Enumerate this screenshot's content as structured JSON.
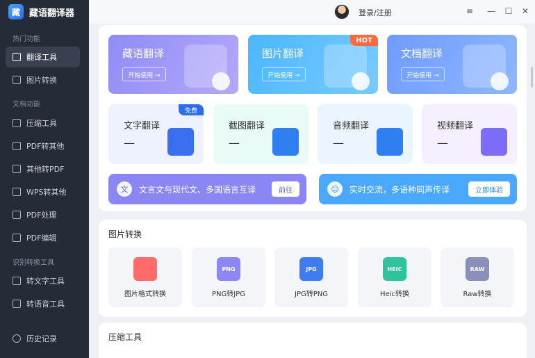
{
  "app": {
    "name": "藏语翻译器",
    "logo_text": "藏"
  },
  "topbar": {
    "login": "登录/注册",
    "menu_icon": "≡",
    "min_icon": "—",
    "max_icon": "☐",
    "close_icon": "✕"
  },
  "sidebar": {
    "sections": [
      {
        "title": "热门功能"
      },
      {
        "title": "文档功能"
      },
      {
        "title": "识别转换工具"
      }
    ],
    "items": [
      {
        "label": "翻译工具",
        "active": true
      },
      {
        "label": "图片转换"
      },
      {
        "label": "压缩工具"
      },
      {
        "label": "PDF转其他"
      },
      {
        "label": "其他转PDF"
      },
      {
        "label": "WPS转其他"
      },
      {
        "label": "PDF处理"
      },
      {
        "label": "PDF编辑"
      },
      {
        "label": "转文字工具"
      },
      {
        "label": "转语音工具"
      },
      {
        "label": "历史记录"
      }
    ]
  },
  "main": {
    "big_cards": [
      {
        "title": "藏语翻译",
        "button": "开始使用 →",
        "color1": "#8f8cf6",
        "color2": "#b4a8fb"
      },
      {
        "title": "图片翻译",
        "button": "开始使用 →",
        "badge": "HOT",
        "color1": "#4bb6ff",
        "color2": "#79cbff"
      },
      {
        "title": "文档翻译",
        "button": "开始使用 →",
        "color1": "#6f9bff",
        "color2": "#8fb7ff"
      }
    ],
    "small_cards": [
      {
        "title": "文字翻译",
        "value": "—",
        "badge": "免费",
        "bg": "#eef2ff",
        "art": "#3a6ff0"
      },
      {
        "title": "截图翻译",
        "value": "—",
        "bg": "#e9fbf7",
        "art": "#2f7ff0"
      },
      {
        "title": "音频翻译",
        "value": "—",
        "bg": "#eaf5ff",
        "art": "#2f7ff0"
      },
      {
        "title": "视频翻译",
        "value": "—",
        "bg": "#f6efff",
        "art": "#7c6cf6"
      }
    ],
    "wide_cards": [
      {
        "icon": "文",
        "text": "文言文与现代文、多国语言互译",
        "button": "前往",
        "color": "#8a86f3"
      },
      {
        "icon": "☺",
        "text": "实时交流，多语种同声传译",
        "button": "立即体验",
        "color": "#4aa8ff"
      }
    ],
    "image_section": {
      "title": "图片转换",
      "tools": [
        {
          "label": "图片格式转换",
          "icon_text": "",
          "color": "#ff6b6b"
        },
        {
          "label": "PNG转JPG",
          "icon_text": "PNG",
          "color": "#8d86f3"
        },
        {
          "label": "JPG转PNG",
          "icon_text": "JPG",
          "color": "#3f7cf2"
        },
        {
          "label": "Heic转换",
          "icon_text": "HEIC",
          "color": "#2ec39a"
        },
        {
          "label": "Raw转换",
          "icon_text": "RAW",
          "color": "#8a90b8"
        }
      ]
    },
    "compress_section": {
      "title": "压缩工具"
    }
  }
}
